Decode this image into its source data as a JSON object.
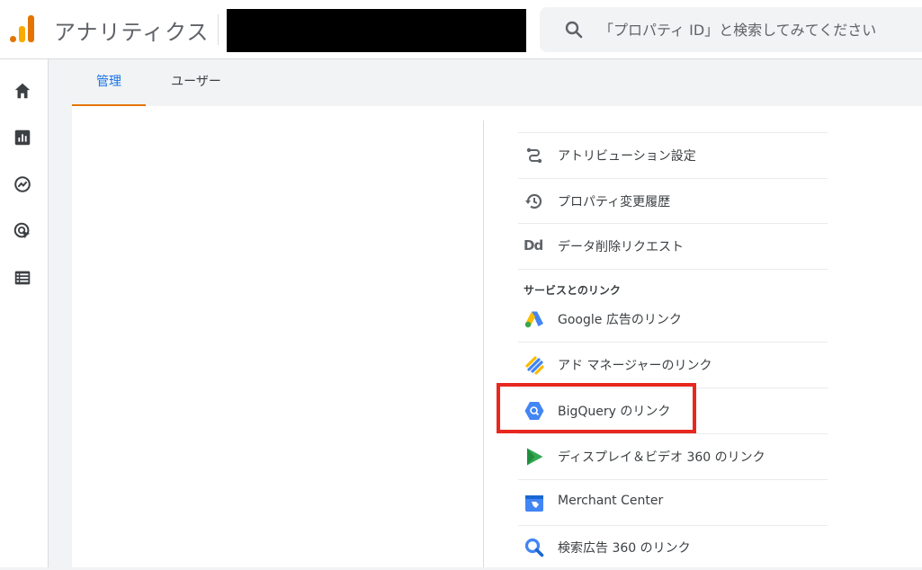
{
  "header": {
    "app_title": "アナリティクス",
    "search_placeholder": "「プロパティ ID」と検索してみてください"
  },
  "colors": {
    "accent_blue": "#1a73e8",
    "tab_underline": "#e37400",
    "highlight_red": "#e8281f"
  },
  "rail": {
    "icons": [
      "home-icon",
      "reports-icon",
      "explore-icon",
      "advertising-icon",
      "list-icon"
    ]
  },
  "tabs": [
    {
      "label": "管理",
      "active": true
    },
    {
      "label": "ユーザー",
      "active": false
    }
  ],
  "menu": {
    "items": [
      {
        "label": "アトリビューション設定",
        "icon": "attribution-icon"
      },
      {
        "label": "プロパティ変更履歴",
        "icon": "history-icon"
      },
      {
        "label": "データ削除リクエスト",
        "icon": "data-deletion-icon",
        "icon_text": "Dd"
      }
    ],
    "section_title": "サービスとのリンク",
    "links": [
      {
        "label": "Google 広告のリンク",
        "icon": "google-ads-icon"
      },
      {
        "label": "アド マネージャーのリンク",
        "icon": "ad-manager-icon"
      },
      {
        "label": "BigQuery のリンク",
        "icon": "bigquery-icon",
        "highlighted": true
      },
      {
        "label": "ディスプレイ＆ビデオ 360 のリンク",
        "icon": "display-video-360-icon"
      },
      {
        "label": "Merchant Center",
        "icon": "merchant-center-icon"
      },
      {
        "label": "検索広告 360 のリンク",
        "icon": "search-ads-360-icon"
      }
    ]
  }
}
